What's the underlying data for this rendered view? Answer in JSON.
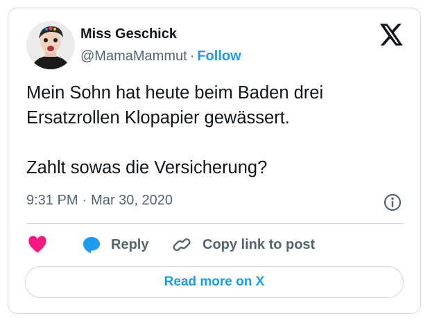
{
  "author": {
    "display_name": "Miss Geschick",
    "handle": "@MamaMammut",
    "separator": "·",
    "follow_label": "Follow"
  },
  "tweet": {
    "text": "Mein Sohn hat heute beim Baden drei\nErsatzrollen Klopapier gewässert.\n\nZahlt sowas die Versicherung?",
    "time": "9:31 PM",
    "separator": "·",
    "date": "Mar 30, 2020"
  },
  "actions": {
    "like_icon": "heart-icon",
    "reply_label": "Reply",
    "reply_icon": "speech-bubble-icon",
    "copy_label": "Copy link to post",
    "copy_icon": "link-icon"
  },
  "footer": {
    "read_more_label": "Read more on X"
  },
  "icons": {
    "brand": "x-logo-icon",
    "info": "info-icon"
  },
  "colors": {
    "accent": "#1d9bf0",
    "like": "#f91880",
    "text_primary": "#0f1419",
    "text_secondary": "#536471",
    "border": "#cfd9de"
  }
}
